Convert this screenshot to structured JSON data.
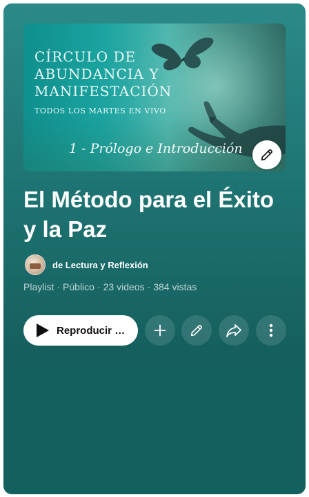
{
  "thumbnail": {
    "line1": "CÍRCULO DE",
    "line2": "ABUNDANCIA Y",
    "line3": "MANIFESTACIÓN",
    "line4": "TODOS LOS MARTES EN VIVO",
    "episode": "1 - Prólogo e Introducción",
    "edit_icon": "pencil-icon"
  },
  "playlist": {
    "title": "El Método para el Éxito y la Paz",
    "owner": "de Lectura y Reflexión",
    "type": "Playlist",
    "visibility": "Público",
    "video_count": "23 videos",
    "views": "384 vistas"
  },
  "actions": {
    "play_label": "Reproducir todo",
    "play_icon": "play-icon",
    "add_icon": "plus-icon",
    "edit_icon": "pencil-icon",
    "share_icon": "share-icon",
    "more_icon": "more-vert-icon"
  },
  "colors": {
    "card_background": "#1f7574",
    "button_background": "#ffffff",
    "text_primary": "#ffffff"
  }
}
